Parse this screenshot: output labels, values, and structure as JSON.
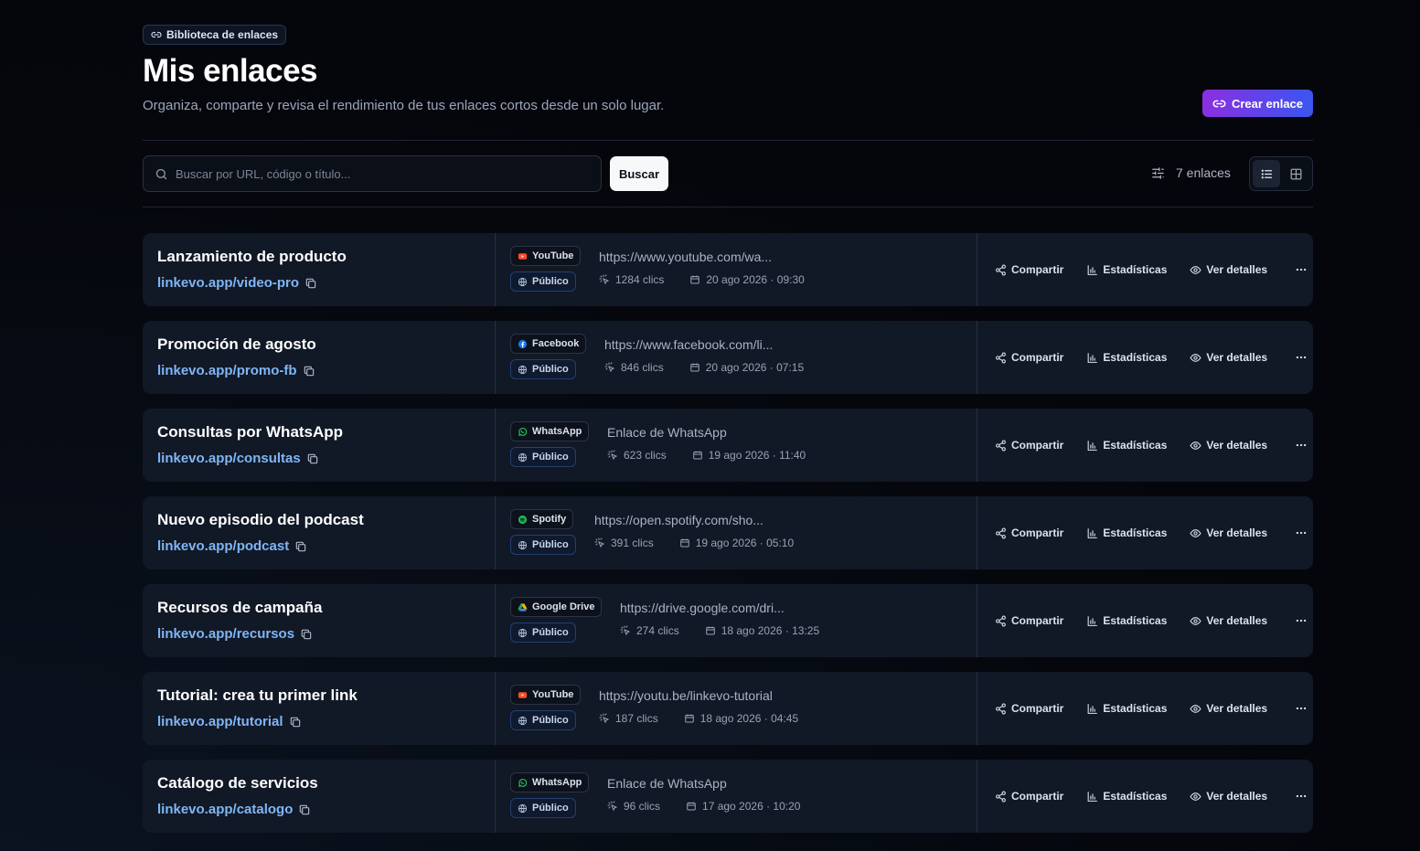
{
  "header": {
    "chip_label": "Biblioteca de enlaces",
    "title": "Mis enlaces",
    "subtitle": "Organiza, comparte y revisa el rendimiento de tus enlaces cortos desde un solo lugar.",
    "create_label": "Crear enlace"
  },
  "toolbar": {
    "search_placeholder": "Buscar por URL, código o título...",
    "search_button": "Buscar",
    "count_label": "7 enlaces"
  },
  "actions": {
    "share": "Compartir",
    "stats": "Estadísticas",
    "details": "Ver detalles"
  },
  "links": [
    {
      "title": "Lanzamiento de producto",
      "short": "linkevo.app/video-pro",
      "platform": "YouTube",
      "platform_icon": "youtube-icon",
      "visibility": "Público",
      "url": "https://www.youtube.com/wa...",
      "clicks": "1284 clics",
      "date": "20 ago 2026 · 09:30"
    },
    {
      "title": "Promoción de agosto",
      "short": "linkevo.app/promo-fb",
      "platform": "Facebook",
      "platform_icon": "facebook-icon",
      "visibility": "Público",
      "url": "https://www.facebook.com/li...",
      "clicks": "846 clics",
      "date": "20 ago 2026 · 07:15"
    },
    {
      "title": "Consultas por WhatsApp",
      "short": "linkevo.app/consultas",
      "platform": "WhatsApp",
      "platform_icon": "whatsapp-icon",
      "visibility": "Público",
      "url": "Enlace de WhatsApp",
      "clicks": "623 clics",
      "date": "19 ago 2026 · 11:40"
    },
    {
      "title": "Nuevo episodio del podcast",
      "short": "linkevo.app/podcast",
      "platform": "Spotify",
      "platform_icon": "spotify-icon",
      "visibility": "Público",
      "url": "https://open.spotify.com/sho...",
      "clicks": "391 clics",
      "date": "19 ago 2026 · 05:10"
    },
    {
      "title": "Recursos de campaña",
      "short": "linkevo.app/recursos",
      "platform": "Google Drive",
      "platform_icon": "google-drive-icon",
      "visibility": "Público",
      "url": "https://drive.google.com/dri...",
      "clicks": "274 clics",
      "date": "18 ago 2026 · 13:25"
    },
    {
      "title": "Tutorial: crea tu primer link",
      "short": "linkevo.app/tutorial",
      "platform": "YouTube",
      "platform_icon": "youtube-icon",
      "visibility": "Público",
      "url": "https://youtu.be/linkevo-tutorial",
      "clicks": "187 clics",
      "date": "18 ago 2026 · 04:45"
    },
    {
      "title": "Catálogo de servicios",
      "short": "linkevo.app/catalogo",
      "platform": "WhatsApp",
      "platform_icon": "whatsapp-icon",
      "visibility": "Público",
      "url": "Enlace de WhatsApp",
      "clicks": "96 clics",
      "date": "17 ago 2026 · 10:20"
    }
  ],
  "colors": {
    "accent_start": "#8b2fe0",
    "accent_end": "#3a55f0",
    "short_link": "#7fb6f5",
    "youtube": "#ff4e2a",
    "facebook": "#1877f2",
    "whatsapp": "#25d366",
    "spotify": "#1db954"
  }
}
